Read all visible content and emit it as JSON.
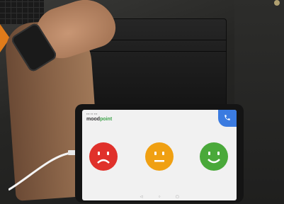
{
  "app": {
    "brand_prefix": "mood",
    "brand_suffix": "point"
  },
  "icons": {
    "call": "phone-icon",
    "sad": "sad-face-icon",
    "neutral": "neutral-face-icon",
    "happy": "happy-face-icon"
  },
  "colors": {
    "sad": "#e0312b",
    "neutral": "#f0a012",
    "happy": "#4aa93a",
    "call_button": "#3b7be0",
    "brand_accent": "#3da34a"
  },
  "nav": {
    "back": "◁",
    "home": "○",
    "recent": "▢"
  }
}
